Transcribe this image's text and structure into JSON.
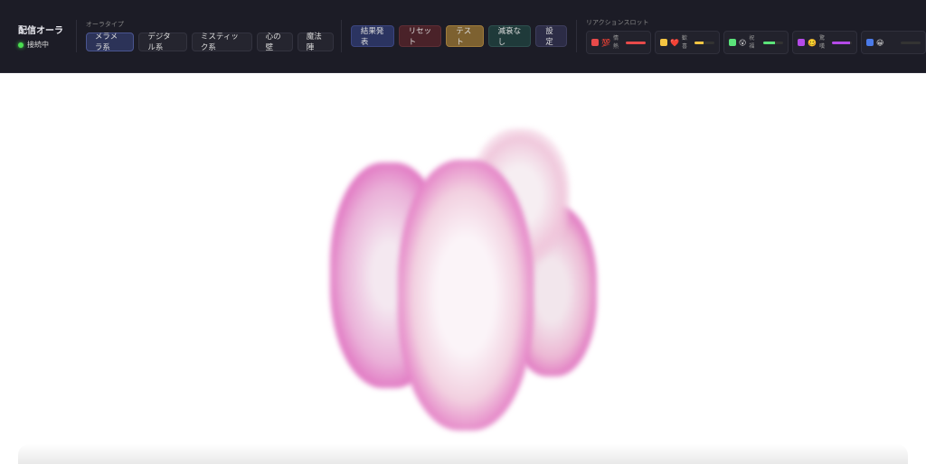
{
  "brand": {
    "title": "配信オーラ",
    "status": "接続中"
  },
  "aura_types": {
    "label": "オーラタイプ",
    "items": [
      "メラメラ系",
      "デジタル系",
      "ミスティック系",
      "心の壁",
      "魔法陣"
    ],
    "selected": 0
  },
  "actions": [
    {
      "label": "結果発表",
      "bg": "#2b3461",
      "border": "#3c4680"
    },
    {
      "label": "リセット",
      "bg": "#4a2229",
      "border": "#5e2e35"
    },
    {
      "label": "テスト",
      "bg": "#7d6130",
      "border": "#a07c3c"
    },
    {
      "label": "減衰なし",
      "bg": "#1f3a3a",
      "border": "#2e4e4e"
    },
    {
      "label": "設定",
      "bg": "#2c2c46",
      "border": "#3d3d5c"
    }
  ],
  "reactions": {
    "label": "リアクションスロット",
    "slots": [
      {
        "color": "#e84a4a",
        "emoji": "💯",
        "label": "情熱",
        "level": 1.0
      },
      {
        "color": "#f5c542",
        "emoji": "❤️",
        "label": "歓喜",
        "level": 0.45
      },
      {
        "color": "#5be37a",
        "emoji": "😮",
        "label": "祝福",
        "level": 0.6
      },
      {
        "color": "#b44ae8",
        "emoji": "🥴",
        "label": "驚嘆",
        "level": 0.9
      },
      {
        "color": "#4a7ae8",
        "emoji": "😀",
        "label": "",
        "level": 0
      }
    ]
  }
}
